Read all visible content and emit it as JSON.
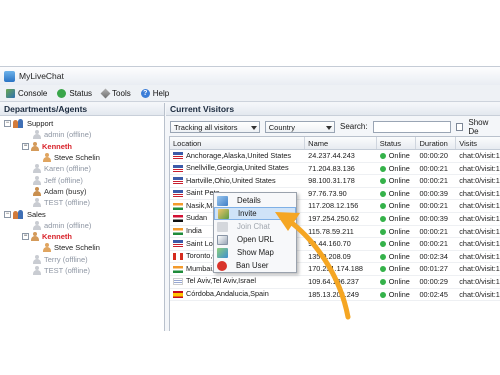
{
  "window": {
    "title": "MyLiveChat"
  },
  "toolbar": {
    "items": [
      {
        "label": "Console",
        "icon": "console-icon"
      },
      {
        "label": "Status",
        "icon": "status-icon"
      },
      {
        "label": "Tools",
        "icon": "tools-icon"
      },
      {
        "label": "Help",
        "icon": "help-icon"
      }
    ]
  },
  "left_pane": {
    "header": "Departments/Agents",
    "tree": [
      {
        "type": "group",
        "expand": "−",
        "label": "Support"
      },
      {
        "type": "agent",
        "label": "admin (offline)",
        "state": "offline"
      },
      {
        "type": "agent",
        "label": "Kenneth",
        "state": "active",
        "expand": "−"
      },
      {
        "type": "visitor",
        "label": "Steve Schelin"
      },
      {
        "type": "agent",
        "label": "Karen (offline)",
        "state": "offline"
      },
      {
        "type": "agent",
        "label": "Jeff (offline)",
        "state": "offline"
      },
      {
        "type": "agent",
        "label": "Adam (busy)",
        "state": "busy"
      },
      {
        "type": "agent",
        "label": "TEST (offline)",
        "state": "offline"
      },
      {
        "type": "group",
        "expand": "−",
        "label": "Sales"
      },
      {
        "type": "agent",
        "label": "admin (offline)",
        "state": "offline"
      },
      {
        "type": "agent",
        "label": "Kenneth",
        "state": "active",
        "expand": "−"
      },
      {
        "type": "visitor",
        "label": "Steve Schelin"
      },
      {
        "type": "agent",
        "label": "Terry (offline)",
        "state": "offline"
      },
      {
        "type": "agent",
        "label": "TEST (offline)",
        "state": "offline"
      }
    ]
  },
  "right_pane": {
    "header": "Current Visitors",
    "filter": {
      "tracking": "Tracking all visitors",
      "country": "Country",
      "search_label": "Search:",
      "search_value": "",
      "show_label": "Show De"
    },
    "columns": [
      "Location",
      "Name",
      "Status",
      "Duration",
      "Visits"
    ],
    "rows": [
      {
        "location": "Anchorage,Alaska,United States",
        "name": "24.237.44.243",
        "status": "Online",
        "duration": "00:00:20",
        "visits": "chat:0/visit:1",
        "flag": "us"
      },
      {
        "location": "Snellville,Georgia,United States",
        "name": "71.204.83.136",
        "status": "Online",
        "duration": "00:00:21",
        "visits": "chat:0/visit:1",
        "flag": "us"
      },
      {
        "location": "Hartville,Ohio,United States",
        "name": "98.100.31.178",
        "status": "Online",
        "duration": "00:00:21",
        "visits": "chat:0/visit:1",
        "flag": "us"
      },
      {
        "location": "Saint Pete",
        "name": "97.76.73.90",
        "status": "Online",
        "duration": "00:00:39",
        "visits": "chat:0/visit:1",
        "flag": "us"
      },
      {
        "location": "Nasik,Ma",
        "name": "117.208.12.156",
        "status": "Online",
        "duration": "00:00:21",
        "visits": "chat:0/visit:1",
        "flag": "in"
      },
      {
        "location": "Sudan",
        "name": "197.254.250.62",
        "status": "Online",
        "duration": "00:00:39",
        "visits": "chat:0/visit:1",
        "flag": "sd"
      },
      {
        "location": "India",
        "name": "115.78.59.211",
        "status": "Online",
        "duration": "00:00:21",
        "visits": "chat:0/visit:1",
        "flag": "in"
      },
      {
        "location": "Saint Lou",
        "name": "99.44.160.70",
        "status": "Online",
        "duration": "00:00:21",
        "visits": "chat:0/visit:1",
        "flag": "us"
      },
      {
        "location": "Toronto,O",
        "name": "135.0.208.09",
        "status": "Online",
        "duration": "00:02:34",
        "visits": "chat:0/visit:1",
        "flag": "ca"
      },
      {
        "location": "Mumbai,M",
        "name": "170.251.174.188",
        "status": "Online",
        "duration": "00:01:27",
        "visits": "chat:0/visit:1",
        "flag": "in"
      },
      {
        "location": "Tel Aviv,Tel Aviv,Israel",
        "name": "109.64.196.237",
        "status": "Online",
        "duration": "00:00:29",
        "visits": "chat:0/visit:1",
        "flag": "il"
      },
      {
        "location": "Córdoba,Andalucia,Spain",
        "name": "185.13.202.249",
        "status": "Online",
        "duration": "00:02:45",
        "visits": "chat:0/visit:1",
        "flag": "es"
      }
    ]
  },
  "context_menu": {
    "items": [
      {
        "label": "Details",
        "icon": "details-icon",
        "state": "normal"
      },
      {
        "label": "Invite",
        "icon": "invite-icon",
        "state": "highlighted"
      },
      {
        "label": "Join Chat",
        "icon": "join-chat-icon",
        "state": "disabled"
      },
      {
        "label": "Open URL",
        "icon": "open-url-icon",
        "state": "normal"
      },
      {
        "label": "Show Map",
        "icon": "map-icon",
        "state": "normal"
      },
      {
        "label": "Ban User",
        "icon": "ban-icon",
        "state": "normal"
      }
    ]
  },
  "colors": {
    "accent_arrow": "#f5a623",
    "online_dot": "#35b24a",
    "active_agent": "#d8222a",
    "highlight": "#cfe3f8"
  }
}
